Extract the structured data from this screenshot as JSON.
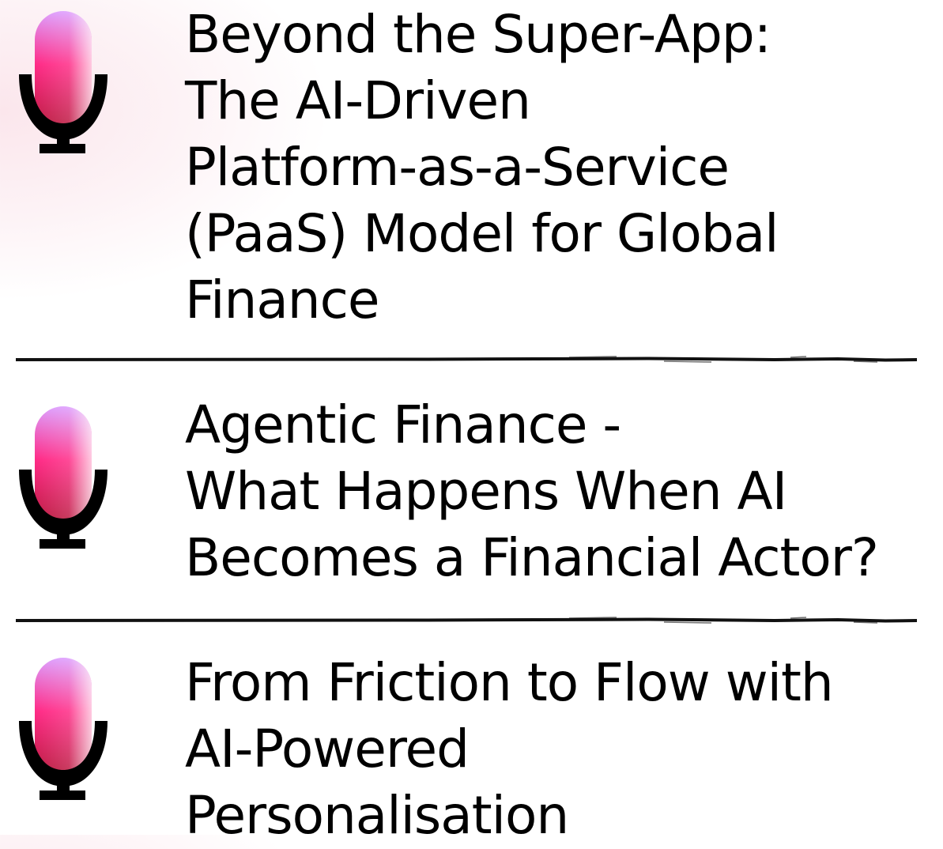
{
  "episodes": [
    {
      "icon": "microphone-icon",
      "title_lines": [
        "Beyond the Super-App:",
        "The AI-Driven",
        "Platform-as-a-Service",
        "(PaaS) Model for Global",
        "Finance"
      ]
    },
    {
      "icon": "microphone-icon",
      "title_lines": [
        "Agentic Finance -",
        "What Happens When AI",
        "Becomes a Financial Actor?"
      ]
    },
    {
      "icon": "microphone-icon",
      "title_lines": [
        "From Friction to Flow with",
        "AI-Powered",
        "Personalisation"
      ]
    }
  ],
  "colors": {
    "mic_top": "#e8a6ff",
    "mic_mid": "#ff1f7a",
    "mic_bottom": "#c81e45",
    "text": "#000000",
    "divider": "#111111"
  }
}
